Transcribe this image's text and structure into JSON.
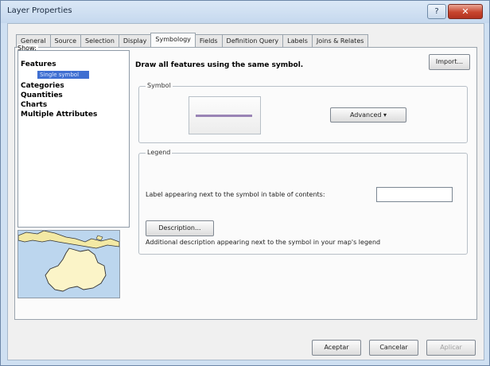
{
  "window": {
    "title": "Layer Properties",
    "close_glyph": "✕",
    "help_glyph": "?"
  },
  "tabs": [
    "General",
    "Source",
    "Selection",
    "Display",
    "Symbology",
    "Fields",
    "Definition Query",
    "Labels",
    "Joins & Relates"
  ],
  "show": {
    "label": "Show:",
    "items": [
      "Features",
      "Categories",
      "Quantities",
      "Charts",
      "Multiple Attributes"
    ],
    "selected_subitem": "Single symbol"
  },
  "main": {
    "headline": "Draw all features using the same symbol.",
    "import_label": "Import..."
  },
  "symbol_group": {
    "title": "Symbol",
    "advanced_label": "Advanced ▾",
    "symbol_color": "#9a84b5"
  },
  "legend_group": {
    "title": "Legend",
    "field_label": "Label appearing next to the symbol in table of contents:",
    "field_value": "",
    "description_button": "Description...",
    "description_hint": "Additional description appearing next to the symbol in your map's legend"
  },
  "footer": {
    "ok_label": "Aceptar",
    "cancel_label": "Cancelar",
    "apply_label": "Aplicar"
  },
  "colors": {
    "selection": "#3f6fd1",
    "window_border": "#6d87a8",
    "close_button": "#c7452e"
  }
}
